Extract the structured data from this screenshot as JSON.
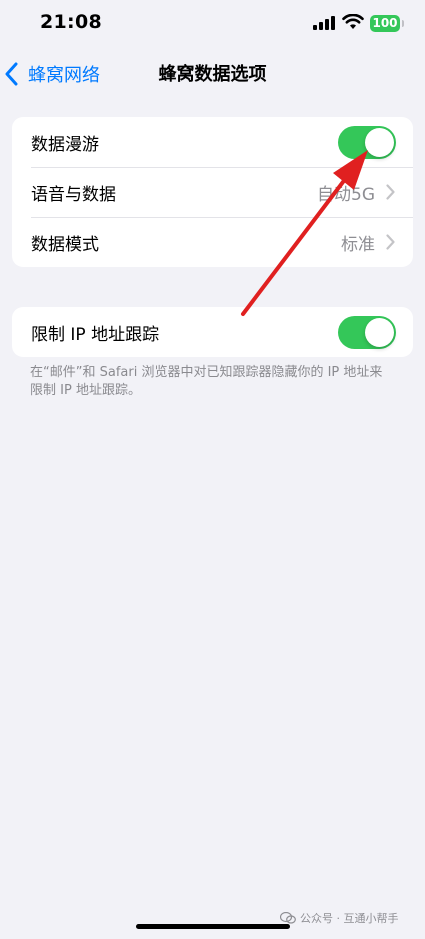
{
  "status_bar": {
    "time": "21:08",
    "battery": "100"
  },
  "nav": {
    "back_label": "蜂窝网络",
    "title": "蜂窝数据选项"
  },
  "group1": {
    "rows": [
      {
        "label": "数据漫游",
        "toggle": true
      },
      {
        "label": "语音与数据",
        "value": "自动5G"
      },
      {
        "label": "数据模式",
        "value": "标准"
      }
    ]
  },
  "group2": {
    "rows": [
      {
        "label": "限制 IP 地址跟踪",
        "toggle": true
      }
    ],
    "footer": "在“邮件”和 Safari 浏览器中对已知跟踪器隐藏你的 IP 地址来限制 IP 地址跟踪。"
  },
  "watermark": {
    "text": "公众号 · 互通小帮手"
  },
  "colors": {
    "accent": "#007aff",
    "toggle_on": "#34c759",
    "annotation_arrow": "#e02020"
  },
  "icons": [
    "back-chevron-icon",
    "signal-icon",
    "wifi-icon",
    "battery-icon",
    "chevron-right-icon",
    "wechat-icon"
  ]
}
